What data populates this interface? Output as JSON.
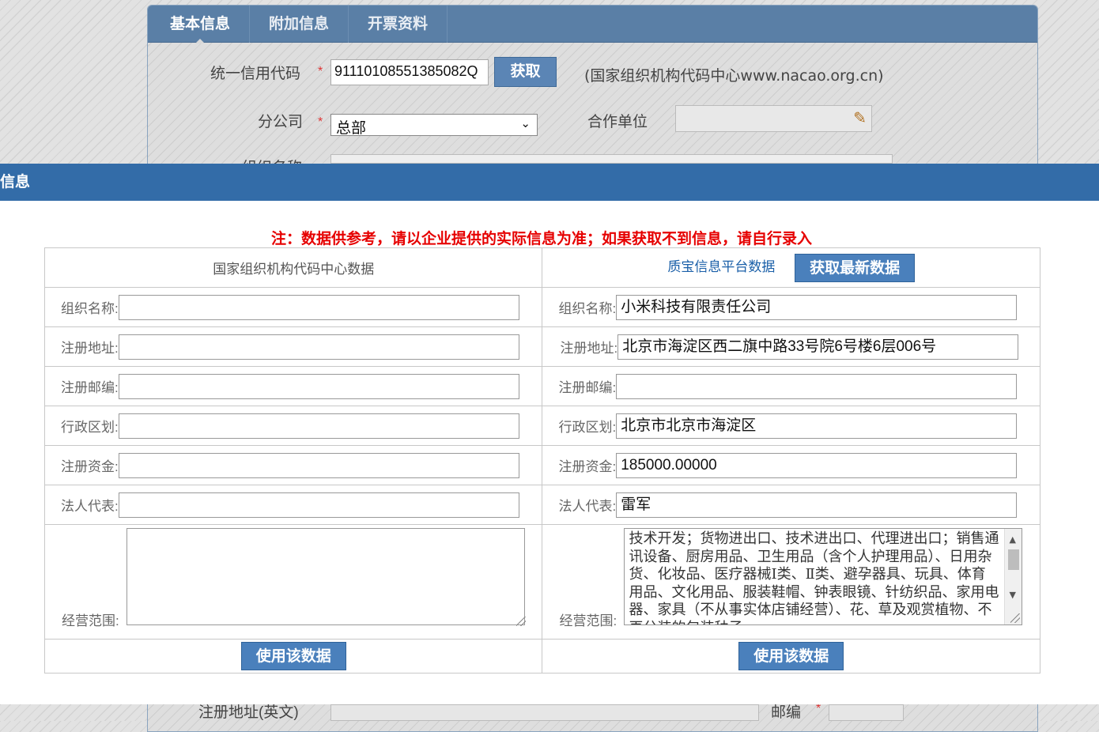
{
  "background": {
    "tabs": [
      "基本信息",
      "附加信息",
      "开票资料"
    ],
    "credit_code_label": "统一信用代码",
    "credit_code_value": "91110108551385082Q",
    "fetch_button": "获取",
    "credit_note": "(国家组织机构代码中心www.nacao.org.cn)",
    "branch_label": "分公司",
    "branch_value": "总部",
    "partner_label": "合作单位",
    "org_name_label": "组织名称",
    "required_mark": "*",
    "reg_address_en_label": "注册地址(英文)",
    "postcode_label": "邮编"
  },
  "modal": {
    "title": "信息",
    "notice": "注：数据供参考，请以企业提供的实际信息为准；如果获取不到信息，请自行录入",
    "left_header": "国家组织机构代码中心数据",
    "right_header": "质宝信息平台数据",
    "refresh_button": "获取最新数据",
    "use_button": "使用该数据",
    "rows": [
      {
        "label": "组织名称:",
        "left": "",
        "right": "小米科技有限责任公司"
      },
      {
        "label": "注册地址:",
        "left": "",
        "right": "北京市海淀区西二旗中路33号院6号楼6层006号"
      },
      {
        "label": "注册邮编:",
        "left": "",
        "right": ""
      },
      {
        "label": "行政区划:",
        "left": "",
        "right": "北京市北京市海淀区"
      },
      {
        "label": "注册资金:",
        "left": "",
        "right": "185000.00000"
      },
      {
        "label": "法人代表:",
        "left": "",
        "right": "雷军"
      }
    ],
    "scope_label": "经营范围:",
    "scope_left": "",
    "scope_right": "技术开发；货物进出口、技术进出口、代理进出口；销售通讯设备、厨房用品、卫生用品（含个人护理用品）、日用杂货、化妆品、医疗器械Ⅰ类、Ⅱ类、避孕器具、玩具、体育用品、文化用品、服装鞋帽、钟表眼镜、针纺织品、家用电器、家具（不从事实体店铺经营）、花、草及观赏植物、不再分装的包装种子"
  }
}
